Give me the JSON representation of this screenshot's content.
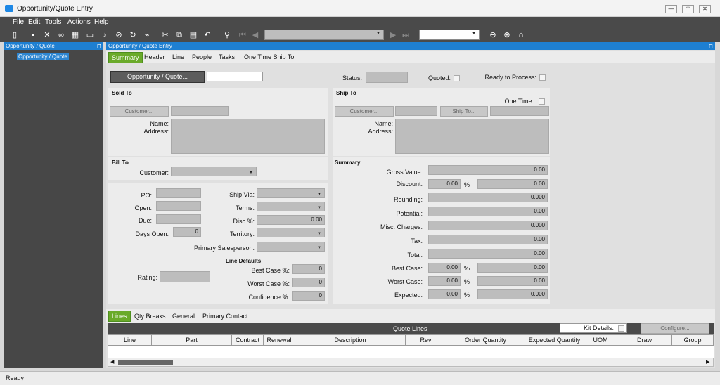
{
  "window": {
    "title": "Opportunity/Quote Entry"
  },
  "menu": [
    "File",
    "Edit",
    "Tools",
    "Actions",
    "Help"
  ],
  "left_panel": {
    "title": "Opportunity / Quote",
    "tree_item": "Opportunity / Quote"
  },
  "main_panel": {
    "title": "Opportunity / Quote Entry"
  },
  "tabs": [
    "Summary",
    "Header",
    "Line",
    "People",
    "Tasks",
    "One Time Ship To"
  ],
  "top_row": {
    "button": "Opportunity / Quote...",
    "status_label": "Status:",
    "quoted_label": "Quoted:",
    "ready_label": "Ready to Process:"
  },
  "sold_to": {
    "title": "Sold To",
    "customer_button": "Customer...",
    "name_label": "Name:",
    "address_label": "Address:"
  },
  "ship_to": {
    "title": "Ship To",
    "one_time_label": "One Time:",
    "customer_button": "Customer...",
    "shipto_button": "Ship To...",
    "name_label": "Name:",
    "address_label": "Address:"
  },
  "bill_to": {
    "title": "Bill To",
    "customer_label": "Customer:"
  },
  "details": {
    "po": "PO:",
    "open": "Open:",
    "due": "Due:",
    "days_open": "Days Open:",
    "days_open_value": "0",
    "ship_via": "Ship Via:",
    "terms": "Terms:",
    "disc": "Disc %:",
    "disc_value": "0.00",
    "territory": "Territory:",
    "salesperson": "Primary Salesperson:",
    "rating": "Rating:"
  },
  "line_defaults": {
    "title": "Line Defaults",
    "best": "Best Case %:",
    "best_value": "0",
    "worst": "Worst Case %:",
    "worst_value": "0",
    "confidence": "Confidence %:",
    "confidence_value": "0"
  },
  "summary": {
    "title": "Summary",
    "rows": [
      {
        "label": "Gross Value:",
        "value": "0.00"
      },
      {
        "label": "Discount:",
        "pct": "0.00",
        "value": "0.00"
      },
      {
        "label": "Rounding:",
        "value": "0.000"
      },
      {
        "label": "Potential:",
        "value": "0.00"
      },
      {
        "label": "Misc. Charges:",
        "value": "0.000"
      },
      {
        "label": "Tax:",
        "value": "0.00"
      },
      {
        "label": "Total:",
        "value": "0.00"
      },
      {
        "label": "Best Case:",
        "pct": "0.00",
        "value": "0.00"
      },
      {
        "label": "Worst Case:",
        "pct": "0.00",
        "value": "0.00"
      },
      {
        "label": "Expected:",
        "pct": "0.00",
        "value": "0.000"
      }
    ],
    "pct_sign": "%"
  },
  "lines_tabs": [
    "Lines",
    "Qty Breaks",
    "General",
    "Primary Contact"
  ],
  "quote_lines": {
    "title": "Quote Lines",
    "kit_details": "Kit Details:",
    "configure": "Configure...",
    "columns": [
      "Line",
      "Part",
      "Contract",
      "Renewal",
      "Description",
      "Rev",
      "Order Quantity",
      "Expected Quantity",
      "UOM",
      "Draw",
      "Group"
    ]
  },
  "status": "Ready"
}
